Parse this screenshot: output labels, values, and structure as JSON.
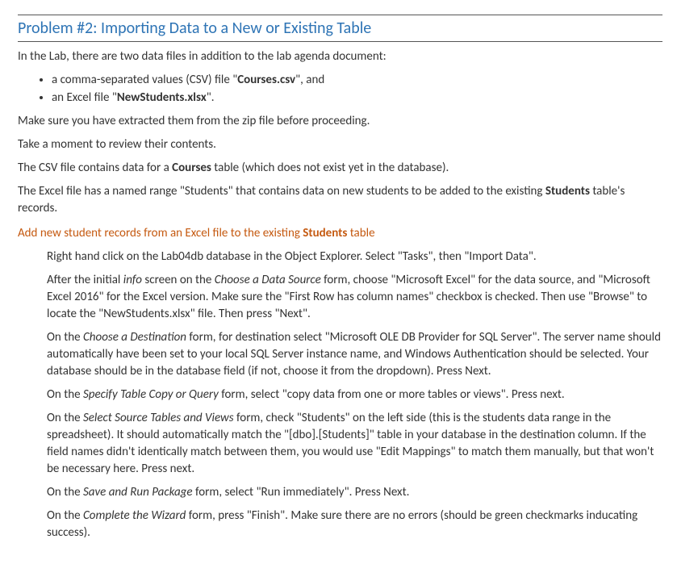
{
  "title": "Problem #2: Importing Data to a New or Existing Table",
  "intro": "In the Lab, there are two data files in addition to the lab agenda document:",
  "bullets": {
    "b1a": "a comma-separated values (CSV) file \"",
    "b1b": "Courses.csv",
    "b1c": "\", and",
    "b2a": "an Excel file \"",
    "b2b": "NewStudents.xlsx",
    "b2c": "\"."
  },
  "p_extract": "Make sure you have extracted them from the zip file before proceeding.",
  "p_review": "Take a moment to review their contents.",
  "p_csv_a": "The CSV file contains data for a ",
  "p_csv_b": "Courses",
  "p_csv_c": " table (which does not exist yet in the database).",
  "p_excel_a": "The Excel file has a named range \"Students\" that contains data on new students to be added to the existing ",
  "p_excel_b": "Students",
  "p_excel_c": " table's records.",
  "orange_a": "Add new student records from an Excel file to the existing ",
  "orange_b": "Students",
  "orange_c": " table",
  "steps": {
    "s1": "Right hand click on the Lab04db database in the Object Explorer. Select \"Tasks\", then \"Import Data\".",
    "s2a": "After the initial ",
    "s2b": "info",
    "s2c": " screen on the ",
    "s2d": "Choose a Data Source",
    "s2e": " form, choose \"Microsoft Excel\" for the data source, and \"Microsoft Excel 2016\" for the Excel version. Make sure the \"First Row has column names\" checkbox is checked. Then use \"Browse\" to locate the \"NewStudents.xlsx\" file. Then press \"Next\".",
    "s3a": "On the ",
    "s3b": "Choose a Destination",
    "s3c": " form, for destination select \"Microsoft OLE DB Provider for SQL Server\". The server name should automatically have been set to your local SQL Server instance name, and Windows Authentication should be selected. Your database should be in the database field (if not, choose it from the dropdown).  Press Next.",
    "s4a": "On the ",
    "s4b": "Specify Table Copy or Query",
    "s4c": " form, select \"copy data from one or more tables or views\". Press next.",
    "s5a": "On the ",
    "s5b": "Select Source Tables and Views",
    "s5c": " form, check \"Students\" on the left side (this is the students data range in the spreadsheet). It should automatically match the \"[dbo].[Students]\" table in your database in the destination column. If the field names didn't identically match between them, you would use \"Edit Mappings\" to match them manually, but that won't be necessary here. Press next.",
    "s6a": "On the ",
    "s6b": "Save and Run Package",
    "s6c": " form, select \"Run immediately\". Press Next.",
    "s7a": "On the ",
    "s7b": "Complete the Wizard",
    "s7c": " form, press \"Finish\". Make sure there are no errors (should be green checkmarks inducating success)."
  }
}
